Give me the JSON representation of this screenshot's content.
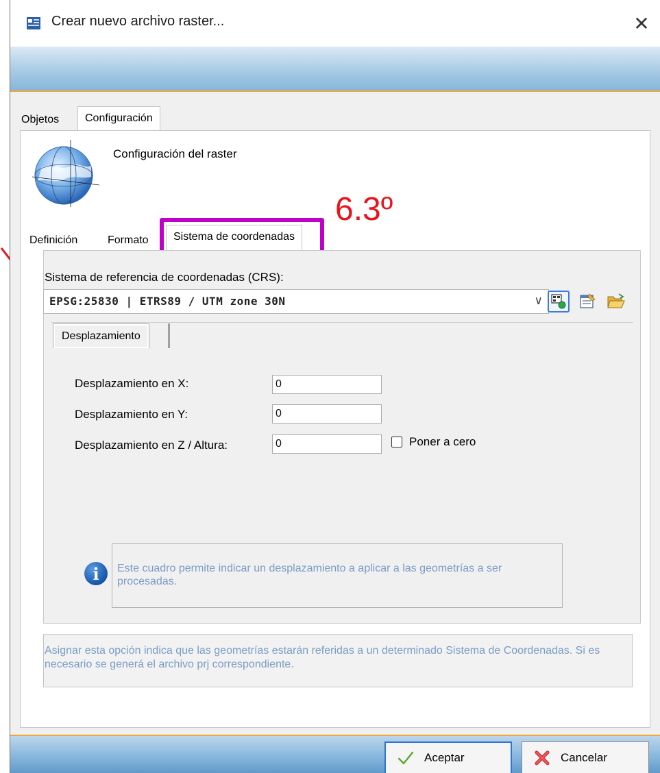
{
  "window": {
    "title": "Crear nuevo archivo raster...",
    "close_glyph": "✕"
  },
  "main_tabs": [
    {
      "label": "Objetos",
      "active": false
    },
    {
      "label": "Configuración",
      "active": true
    }
  ],
  "config": {
    "title": "Configuración del raster",
    "icon": "globe-icon"
  },
  "annotation": {
    "number_label": "6.3º",
    "color": "#e8141b",
    "highlight_color": "#c000c8"
  },
  "sub_tabs": [
    {
      "label": "Definición",
      "active": false
    },
    {
      "label": "Formato",
      "active": false
    },
    {
      "label": "Sistema de coordenadas",
      "active": true
    }
  ],
  "crs": {
    "label": "Sistema de referencia de coordenadas (CRS):",
    "value": "EPSG:25830 | ETRS89 / UTM zone 30N",
    "tools": [
      "crs-select-icon",
      "crs-properties-icon",
      "open-folder-icon"
    ]
  },
  "offset": {
    "tab_label": "Desplazamiento",
    "x_label": "Desplazamiento en X:",
    "x_value": "0",
    "y_label": "Desplazamiento en Y:",
    "y_value": "0",
    "z_label": "Desplazamiento en Z / Altura:",
    "z_value": "0",
    "zero_label": "Poner a cero",
    "zero_checked": false,
    "info_text": "Este cuadro permite indicar un desplazamiento a aplicar a las geometrías a ser procesadas."
  },
  "help_text": "Asignar esta opción indica que las geometrías estarán referidas a un determinado Sistema de Coordenadas. Si es necesario se generá el archivo prj correspondiente.",
  "buttons": {
    "ok": "Aceptar",
    "cancel": "Cancelar"
  }
}
